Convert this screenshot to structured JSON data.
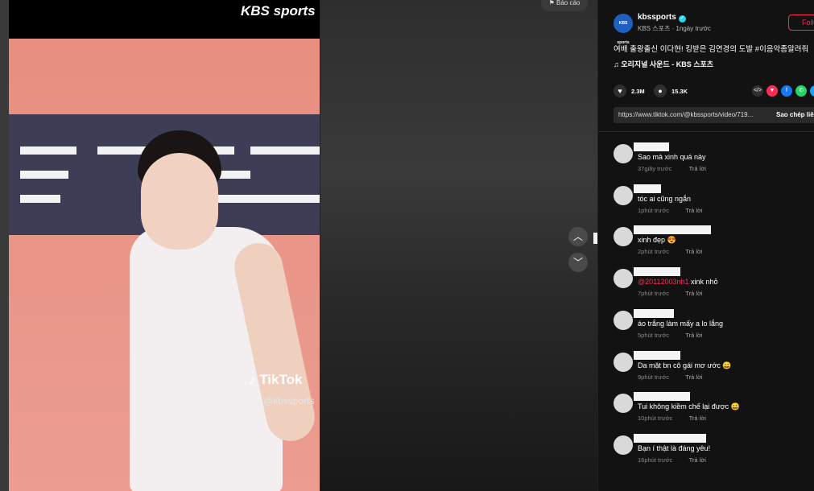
{
  "video": {
    "watermark_logo": "KBS sports",
    "tiktok_brand": "TikTok",
    "tiktok_username": "@kbssports",
    "report_label": "Báo cáo"
  },
  "nav": {
    "up_icon": "chevron-up-icon",
    "down_icon": "chevron-down-icon"
  },
  "author": {
    "avatar_text": "KBS sports",
    "username": "kbssports",
    "verified_icon": "✓",
    "meta": "KBS 스포츠 · 1ngày trước",
    "follow_label": "Follow"
  },
  "caption": "여배 출왕출신 이다현! 킹받은 김연경의 도발 #이음악좀알려줘",
  "sound": "♫  오리지널 사운드 - KBS 스포츠",
  "stats": {
    "likes": "2.3M",
    "comments": "15.3K"
  },
  "share_icons": [
    {
      "icon": "embed-icon",
      "glyph": "</>",
      "color": "#2f2f2f"
    },
    {
      "icon": "send-icon",
      "glyph": "▼",
      "color": "#fe2c55"
    },
    {
      "icon": "facebook-icon",
      "glyph": "f",
      "color": "#1877f2"
    },
    {
      "icon": "whatsapp-icon",
      "glyph": "✆",
      "color": "#25d366"
    },
    {
      "icon": "twitter-icon",
      "glyph": "t",
      "color": "#1da1f2"
    }
  ],
  "link": {
    "url": "https://www.tiktok.com/@kbssports/video/719...",
    "copy_label": "Sao chép liên kết"
  },
  "reply_label": "Trả lời",
  "comments": [
    {
      "text": "Sao mà xinh quá này",
      "time": "37giây trước"
    },
    {
      "text": "tóc ai cũng ngắn",
      "time": "1phút trước"
    },
    {
      "text": "xinh đẹp 😍",
      "time": "2phút trước"
    },
    {
      "mention": "@20112003nh1",
      "text": " xink nhỏ",
      "time": "7phút trước"
    },
    {
      "text": "áo trắng làm mấy a lo lắng",
      "time": "5phút trước"
    },
    {
      "text": "Da mặt bn cô gái mơ ước 😀",
      "time": "9phút trước"
    },
    {
      "text": "Tui không kiềm chế lại được 😀",
      "time": "10phút trước"
    },
    {
      "text": "Bạn í thật là đáng yêu!",
      "time": "16phút trước"
    }
  ]
}
